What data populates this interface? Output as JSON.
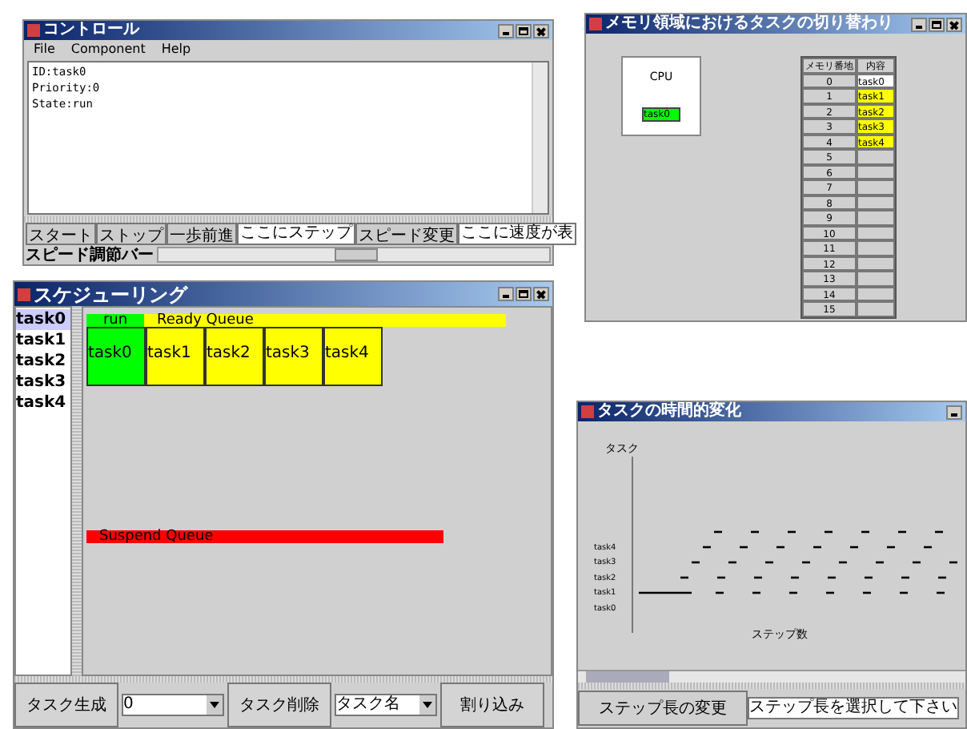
{
  "control_window": {
    "title": "コントロール",
    "menu": [
      "File",
      "Component",
      "Help"
    ],
    "text_lines": [
      "ID:task0",
      "Priority:0",
      "State:run"
    ],
    "buttons": [
      {
        "kind": "button",
        "label": "スタート"
      },
      {
        "kind": "button",
        "label": "ストップ"
      },
      {
        "kind": "button",
        "label": "一歩前進"
      },
      {
        "kind": "field",
        "label": "ここにステップ"
      },
      {
        "kind": "button",
        "label": "スピード変更"
      },
      {
        "kind": "field",
        "label": "ここに速度が表"
      }
    ],
    "speed_label": "スピード調節バー",
    "speed_slider": {
      "level": 0.5
    }
  },
  "memory_window": {
    "title": "メモリ領域におけるタスクの切り替わり",
    "cpu_label": "CPU",
    "cpu_task": "task0",
    "table": {
      "columns": [
        "メモリ番地",
        "内容"
      ],
      "rows": [
        {
          "address": "0",
          "content": "task0",
          "color": "#ffffff"
        },
        {
          "address": "1",
          "content": "task1",
          "color": "#ffff00"
        },
        {
          "address": "2",
          "content": "task2",
          "color": "#ffff00"
        },
        {
          "address": "3",
          "content": "task3",
          "color": "#ffff00"
        },
        {
          "address": "4",
          "content": "task4",
          "color": "#ffff00"
        },
        {
          "address": "5"
        },
        {
          "address": "6"
        },
        {
          "address": "7"
        },
        {
          "address": "8"
        },
        {
          "address": "9"
        },
        {
          "address": "10"
        },
        {
          "address": "11"
        },
        {
          "address": "12"
        },
        {
          "address": "13"
        },
        {
          "address": "14"
        },
        {
          "address": "15"
        }
      ]
    }
  },
  "scheduling_window": {
    "title": "スケジューリング",
    "task_list": [
      {
        "label": "task0",
        "selected": true
      },
      {
        "label": "task1",
        "selected": false
      },
      {
        "label": "task2",
        "selected": false
      },
      {
        "label": "task3",
        "selected": false
      },
      {
        "label": "task4",
        "selected": false
      }
    ],
    "run_label": "run",
    "run_task": "task0",
    "ready_label": "Ready Queue",
    "ready_tasks": [
      "task1",
      "task2",
      "task3",
      "task4"
    ],
    "suspend_label": "Suspend Queue",
    "controls": [
      {
        "kind": "button",
        "label": "タスク生成"
      },
      {
        "kind": "combo",
        "label": "0"
      },
      {
        "kind": "button",
        "label": "タスク削除"
      },
      {
        "kind": "combo",
        "label": "タスク名"
      },
      {
        "kind": "button",
        "label": "割り込み"
      }
    ]
  },
  "timeline_window": {
    "title": "タスクの時間的変化",
    "ylabel": "タスク",
    "xlabel": "ステップ数",
    "rows": [
      "task4",
      "task3",
      "task2",
      "task1",
      "task0"
    ],
    "step_button": "ステップ長の変更",
    "step_field": "ステップ長を選択して下さい"
  }
}
